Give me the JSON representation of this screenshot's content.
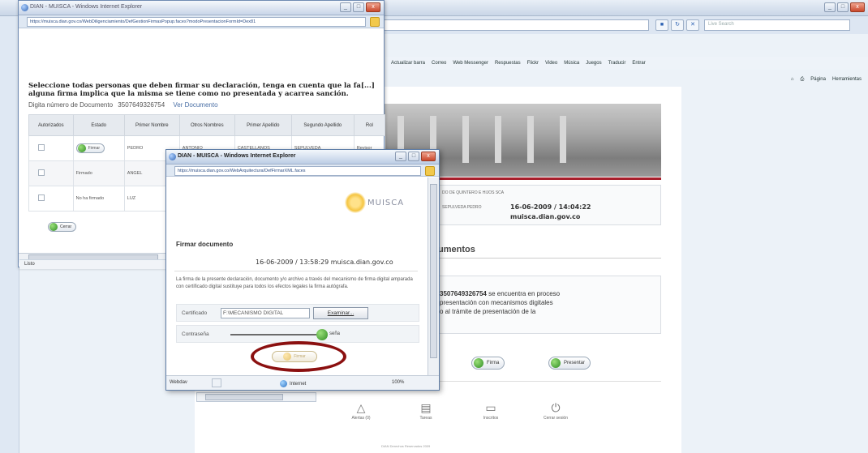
{
  "background_browser": {
    "search_placeholder": "Live Search",
    "links_bar": [
      "Actualizar barra",
      "Correo",
      "Web Messenger",
      "Respuestas",
      "Flickr",
      "Video",
      "Música",
      "Juegos",
      "Traducir",
      "Entrar"
    ],
    "command_bar": [
      "Página",
      "Herramientas"
    ],
    "status_left": "Listo"
  },
  "background_page": {
    "company_line": "DO DE QUINTERO E HIJOS SCA",
    "user_line": "SEPULVEDA PEDRO",
    "datetime": "16-06-2009 / 14:04:22",
    "domain": "muisca.dian.gov.co",
    "section_title": "umentos",
    "process_text_bold": "3507649326754",
    "process_text_1": " se encuentra en proceso",
    "process_text_2": "presentación con mecanismos digitales",
    "process_text_3": "o al trámite de presentación de la",
    "btn_firma": "Firma",
    "btn_presentar": "Presentar",
    "footer": [
      {
        "icon": "bell",
        "label": "Alertas (0)"
      },
      {
        "icon": "doc",
        "label": "Tareas"
      },
      {
        "icon": "folder",
        "label": "Inscritos"
      },
      {
        "icon": "power",
        "label": "Cerrar sesión"
      }
    ],
    "copyright": "DIAN Derechos Reservados 2009"
  },
  "window1": {
    "title": "DIAN - MUISCA - Windows Internet Explorer",
    "url": "https://muisca.dian.gov.co/WebDiligenciamiento/DefGestionFirmasPopup.faces?modoPresentacionFormId=Dex81",
    "heading": "Seleccione todas personas que deben firmar su declaración, tenga en cuenta que la fa[...] alguna firma implica que la misma se tiene como no presentada y acarrea sanción.",
    "doc_label": "Digita número de Documento",
    "doc_number": "3507649326754",
    "doc_link": "Ver Documento",
    "columns": [
      "Autorizados",
      "Estado",
      "Primer Nombre",
      "Otros Nombres",
      "Primer Apellido",
      "Segundo Apellido",
      "Rol"
    ],
    "rows": [
      {
        "estado": "Firmar",
        "primer_nombre": "PEDRO",
        "otros": "ANTONIO",
        "primer_apellido": "CASTELLANOS",
        "segundo_apellido": "SEPULVEDA",
        "rol": "Revisor"
      },
      {
        "estado": "Firmado",
        "primer_nombre": "ANGEL",
        "otros": "",
        "primer_apellido": "",
        "segundo_apellido": "",
        "rol": ""
      },
      {
        "estado": "No ha firmado",
        "primer_nombre": "LUZ",
        "otros": "",
        "primer_apellido": "",
        "segundo_apellido": "",
        "rol": ""
      }
    ],
    "cerrar_label": "Cerrar"
  },
  "window2": {
    "title": "DIAN - MUISCA - Windows Internet Explorer",
    "url": "https://muisca.dian.gov.co/WebArquitectura/DefFirmarXML.faces",
    "logo_word": "MUISCA",
    "section_title": "Firmar documento",
    "datetime_line": "16-06-2009 / 13:58:29 muisca.dian.gov.co",
    "paragraph": "La firma de la presente declaración, documento y/o archivo a través del mecanismo de firma digital amparada con certificado digital sustituye para todos los efectos legales la firma autógrafa.",
    "cert_label": "Certificado",
    "cert_value": "F:\\MECANISMO DIGITAL",
    "examinar_label": "Examinar...",
    "password_label": "Contraseña",
    "password_tail": "seña",
    "firmar_label": "Firmar",
    "status_left": "Webdav",
    "status_zone": "Internet",
    "zoom": "100%"
  }
}
